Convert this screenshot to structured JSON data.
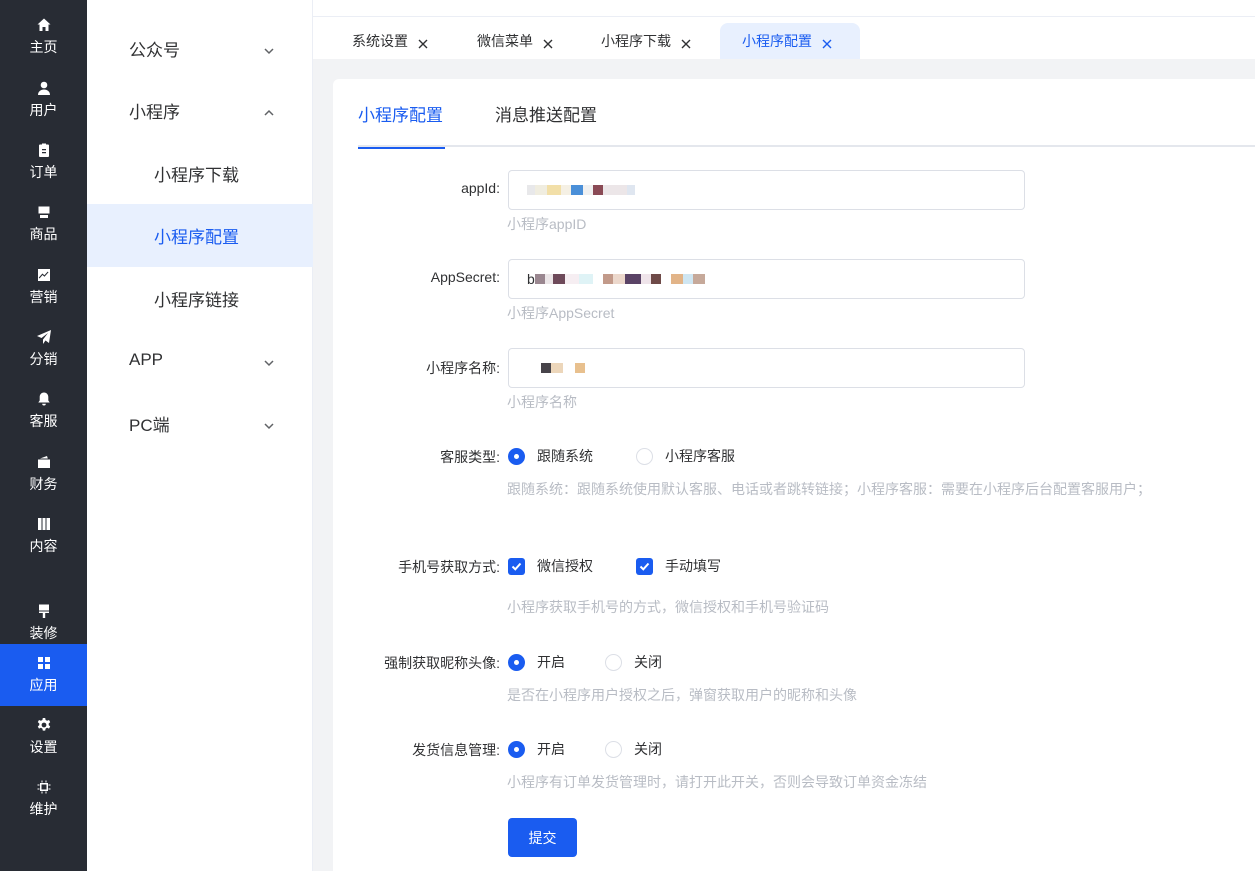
{
  "rail": {
    "items": [
      {
        "label": "主页",
        "icon": "home-icon"
      },
      {
        "label": "用户",
        "icon": "user-icon"
      },
      {
        "label": "订单",
        "icon": "clipboard-icon"
      },
      {
        "label": "商品",
        "icon": "goods-icon"
      },
      {
        "label": "营销",
        "icon": "chart-icon"
      },
      {
        "label": "分销",
        "icon": "send-icon"
      },
      {
        "label": "客服",
        "icon": "bell-icon"
      },
      {
        "label": "财务",
        "icon": "wallet-icon"
      },
      {
        "label": "内容",
        "icon": "book-icon"
      },
      {
        "label": "装修",
        "icon": "brush-icon"
      },
      {
        "label": "应用",
        "icon": "grid-icon"
      },
      {
        "label": "设置",
        "icon": "gear-icon"
      },
      {
        "label": "维护",
        "icon": "chip-icon"
      }
    ],
    "active_index": 10,
    "active_color": "#1a5cf0"
  },
  "submenu": {
    "groups": [
      {
        "label": "公众号"
      },
      {
        "label": "小程序"
      },
      {
        "label": "APP"
      },
      {
        "label": "PC端"
      }
    ],
    "items": [
      {
        "label": "小程序下载"
      },
      {
        "label": "小程序配置"
      },
      {
        "label": "小程序链接"
      }
    ]
  },
  "tabs": [
    {
      "label": "系统设置"
    },
    {
      "label": "微信菜单"
    },
    {
      "label": "小程序下载"
    },
    {
      "label": "小程序配置"
    }
  ],
  "inner_tabs": [
    {
      "label": "小程序配置"
    },
    {
      "label": "消息推送配置"
    }
  ],
  "form": {
    "appid": {
      "label": "appId:",
      "hint": "小程序appID"
    },
    "appsecret": {
      "label": "AppSecret:",
      "value_prefix": "b",
      "hint": "小程序AppSecret"
    },
    "name": {
      "label": "小程序名称:",
      "hint": "小程序名称"
    },
    "service_type": {
      "label": "客服类型:",
      "options": [
        "跟随系统",
        "小程序客服"
      ],
      "selected": "跟随系统",
      "hint": "跟随系统：跟随系统使用默认客服、电话或者跳转链接；小程序客服：需要在小程序后台配置客服用户；"
    },
    "phone_method": {
      "label": "手机号获取方式:",
      "options": [
        "微信授权",
        "手动填写"
      ],
      "checked": [
        "微信授权",
        "手动填写"
      ],
      "hint": "小程序获取手机号的方式，微信授权和手机号验证码"
    },
    "force_avatar": {
      "label": "强制获取昵称头像:",
      "options": [
        "开启",
        "关闭"
      ],
      "selected": "开启",
      "hint": "是否在小程序用户授权之后，弹窗获取用户的昵称和头像"
    },
    "shipping": {
      "label": "发货信息管理:",
      "options": [
        "开启",
        "关闭"
      ],
      "selected": "开启",
      "hint": "小程序有订单发货管理时，请打开此开关，否则会导致订单资金冻结"
    },
    "submit_label": "提交"
  }
}
